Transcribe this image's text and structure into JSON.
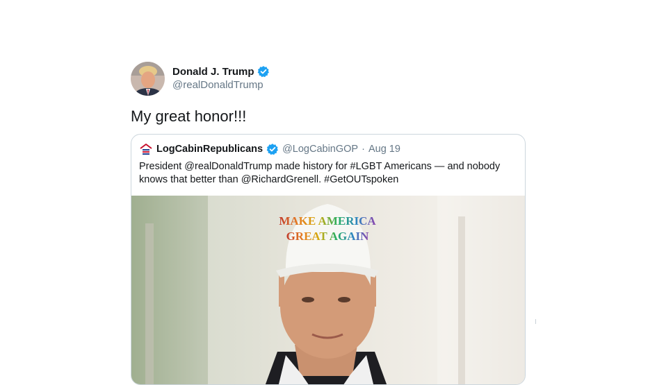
{
  "tweet": {
    "author": {
      "name": "Donald J. Trump",
      "handle": "@realDonaldTrump",
      "verified": true
    },
    "text": "My great honor!!!"
  },
  "quoted_tweet": {
    "author": {
      "name": "LogCabinRepublicans",
      "handle": "@LogCabinGOP",
      "verified": true
    },
    "separator": "·",
    "date": "Aug 19",
    "text": "President @realDonaldTrump made history for #LGBT Americans — and nobody knows that better than @RichardGrenell. #GetOUTspoken",
    "media": {
      "hat_text": "MAKE AMERICA GREAT AGAIN"
    }
  },
  "colors": {
    "text": "#14171a",
    "secondary_text": "#657786",
    "verified_blue": "#1da1f2",
    "card_border": "#ccd6dd"
  },
  "icons": {
    "verified": "verified-badge-icon",
    "logo": "log-cabin-logo-icon"
  }
}
